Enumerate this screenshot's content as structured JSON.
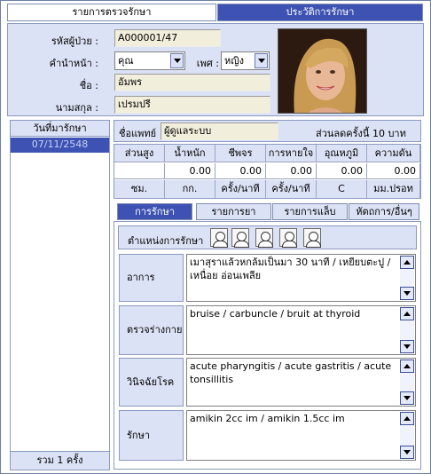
{
  "tabs": {
    "exam_list": "รายการตรวจรักษา",
    "history": "ประวัติการรักษา"
  },
  "patient": {
    "hn_label": "รหัสผู้ป่วย :",
    "hn_value": "A000001/47",
    "prefix_label": "คำนำหน้า :",
    "prefix_value": "คุณ",
    "sex_label": "เพศ :",
    "sex_value": "หญิง",
    "name_label": "ชื่อ :",
    "name_value": "อัมพร",
    "surname_label": "นามสกุล :",
    "surname_value": "เปรมปรี"
  },
  "visits": {
    "header": "วันที่มารักษา",
    "items": [
      "07/11/2548"
    ],
    "total": "รวม 1 ครั้ง"
  },
  "doctor": {
    "label": "ชื่อแพทย์",
    "value": "ผู้ดูแลระบบ",
    "discount": "ส่วนลดครั้งนี้ 10 บาท"
  },
  "vitals": {
    "headers": [
      "ส่วนสูง",
      "น้ำหนัก",
      "ชีพจร",
      "การหายใจ",
      "อุณหภูมิ",
      "ความดัน"
    ],
    "values": [
      "",
      "0.00",
      "0.00",
      "0.00",
      "0.00",
      "0.00"
    ],
    "units": [
      "ซม.",
      "กก.",
      "ครั้ง/นาที",
      "ครั้ง/นาที",
      "C",
      "มม.ปรอท"
    ]
  },
  "subtabs": [
    "การรักษา",
    "รายการยา",
    "รายการแล็บ",
    "หัตถการ/อื่นๆ"
  ],
  "treatment": {
    "position_label": "ตำแหน่งการรักษา",
    "sections": [
      {
        "label": "อาการ",
        "text": "เมาสุราแล้วหกล้มเป็นมา 30 นาที / เหยียบตะปู / เหนื่อย อ่อนเพลีย"
      },
      {
        "label": "ตรวจร่างกาย",
        "text": "bruise / carbuncle / bruit at thyroid"
      },
      {
        "label": "วินิจฉัยโรค",
        "text": "acute pharyngitis / acute gastritis / acute tonsillitis"
      },
      {
        "label": "รักษา",
        "text": "amikin 2cc im / amikin 1.5cc im"
      }
    ]
  },
  "colors": {
    "active_tab": "#3d52b3",
    "panel": "#dce2f5",
    "field": "#f1eedb"
  }
}
